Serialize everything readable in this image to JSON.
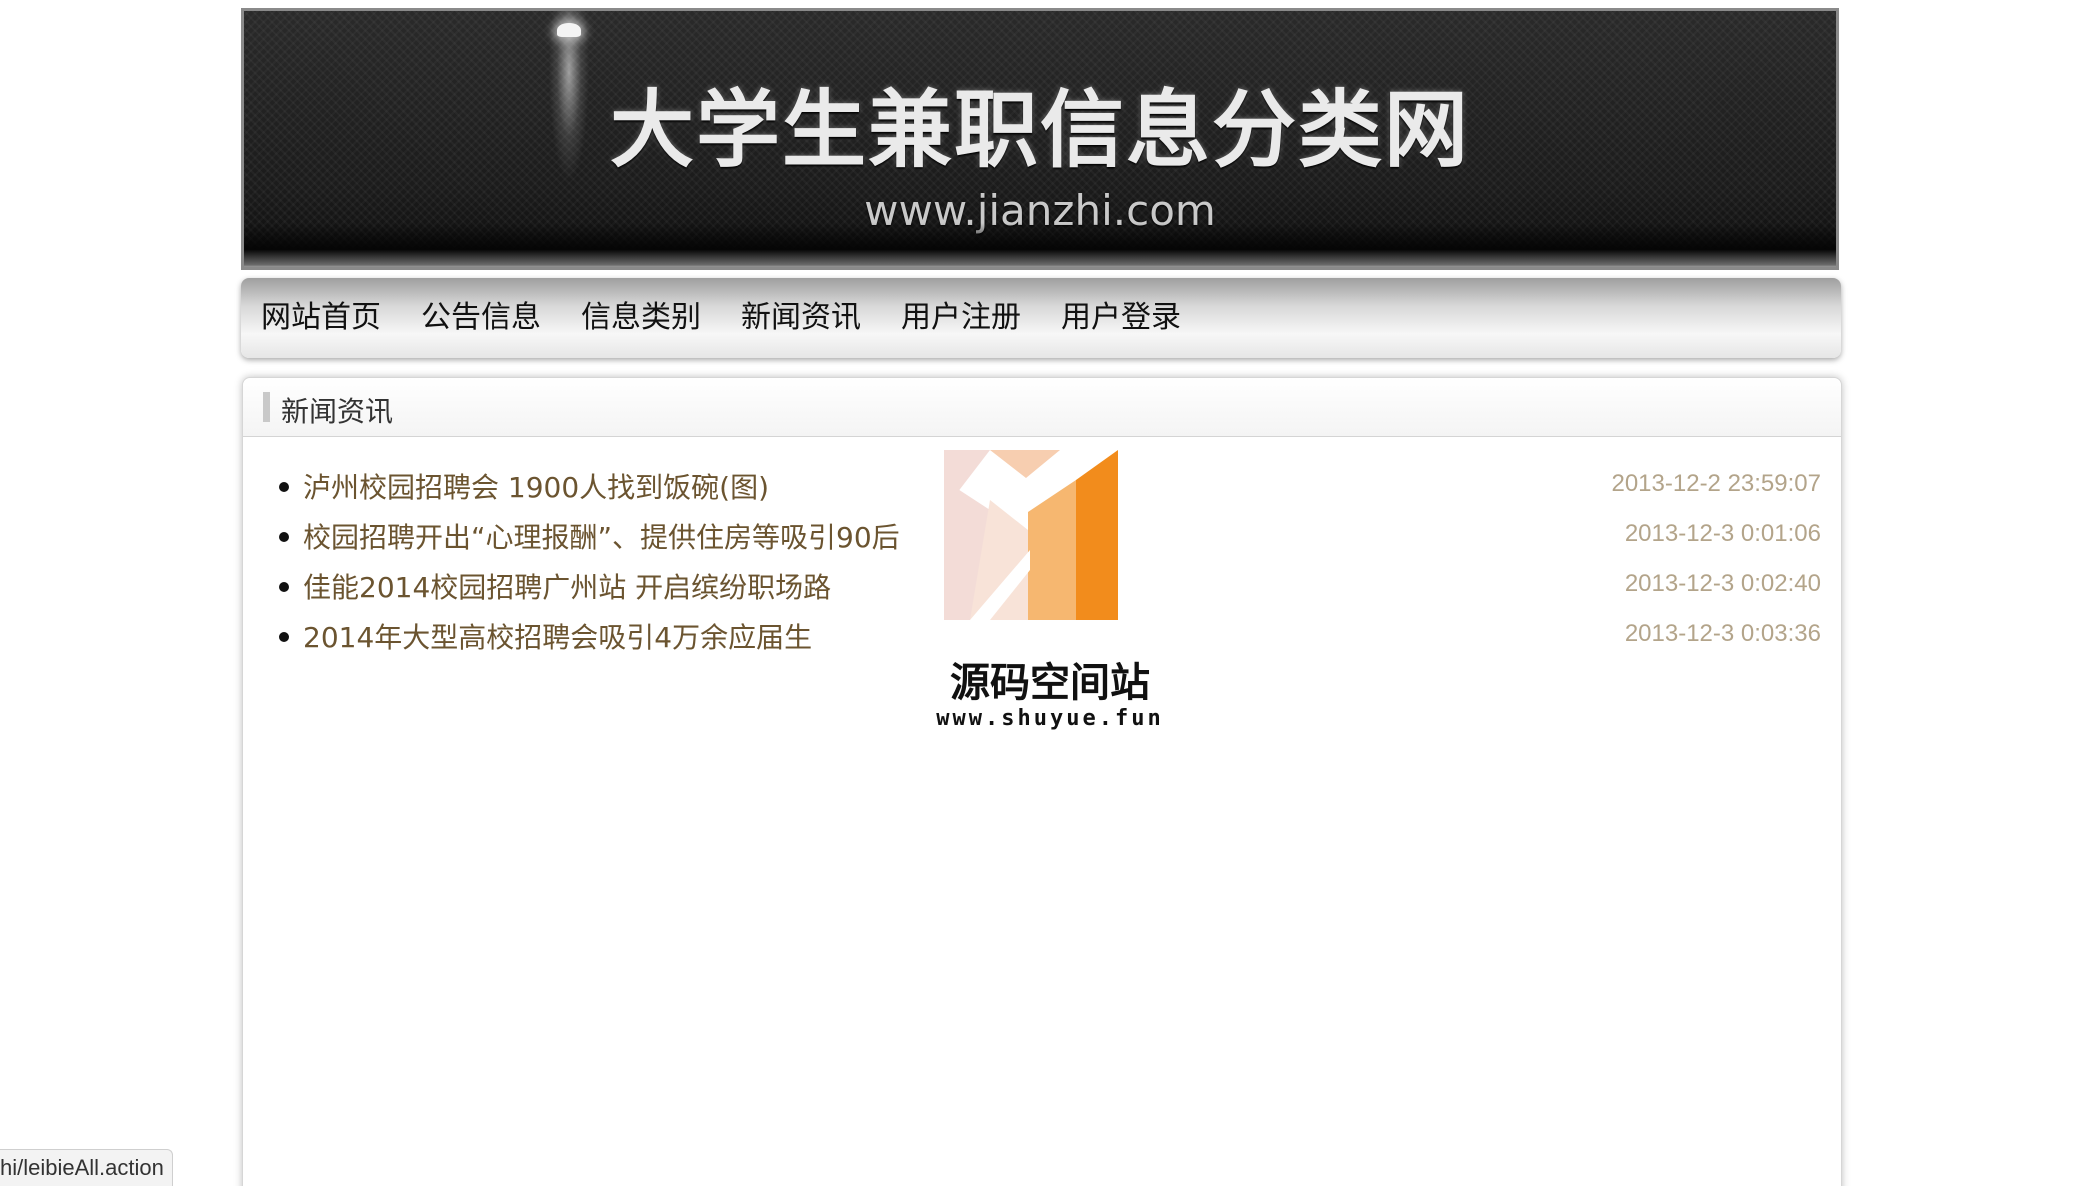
{
  "header": {
    "site_title": "大学生兼职信息分类网",
    "site_url": "www.jianzhi.com"
  },
  "nav": {
    "items": [
      {
        "label": "网站首页"
      },
      {
        "label": "公告信息"
      },
      {
        "label": "信息类别"
      },
      {
        "label": "新闻资讯"
      },
      {
        "label": "用户注册"
      },
      {
        "label": "用户登录"
      }
    ]
  },
  "news": {
    "title": "新闻资讯",
    "items": [
      {
        "title": "泸州校园招聘会 1900人找到饭碗(图)",
        "date": "2013-12-2 23:59:07"
      },
      {
        "title": "校园招聘开出“心理报酬”、提供住房等吸引90后",
        "date": "2013-12-3 0:01:06"
      },
      {
        "title": "佳能2014校园招聘广州站 开启缤纷职场路",
        "date": "2013-12-3 0:02:40"
      },
      {
        "title": "2014年大型高校招聘会吸引4万余应届生",
        "date": "2013-12-3 0:03:36"
      }
    ]
  },
  "watermark": {
    "name": "源码空间站",
    "url": "www.shuyue.fun"
  },
  "status_bar": {
    "url": "hi/leibieAll.action"
  },
  "colors": {
    "news_link": "#6b5430",
    "news_date": "#b3a48a",
    "banner_bg": "#1b1b1b",
    "watermark_orange": "#f28c1c"
  }
}
